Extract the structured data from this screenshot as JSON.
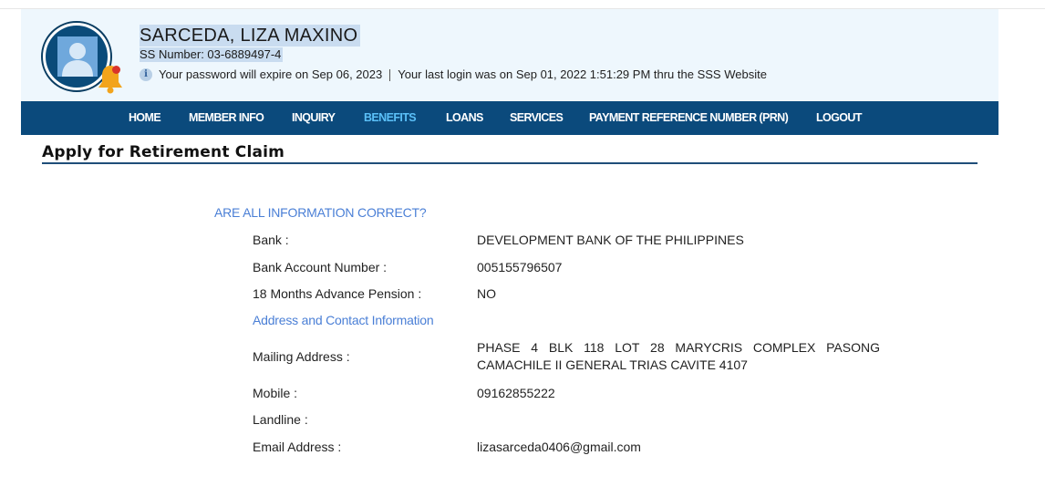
{
  "user": {
    "name": "SARCEDA,  LIZA MAXINO",
    "ss_number": "SS Number: 03-6889497-4",
    "password_notice": "Your password will expire on Sep 06, 2023",
    "last_login": "Your last login was on Sep 01, 2022 1:51:29 PM thru the SSS Website"
  },
  "nav": {
    "items": [
      {
        "label": "HOME",
        "active": false
      },
      {
        "label": "MEMBER INFO",
        "active": false
      },
      {
        "label": "INQUIRY",
        "active": false
      },
      {
        "label": "BENEFITS",
        "active": true
      },
      {
        "label": "LOANS",
        "active": false
      },
      {
        "label": "SERVICES",
        "active": false
      },
      {
        "label": "PAYMENT REFERENCE NUMBER (PRN)",
        "active": false
      },
      {
        "label": "LOGOUT",
        "active": false
      }
    ]
  },
  "page": {
    "title": "Apply for Retirement Claim",
    "section_heading": "ARE ALL INFORMATION CORRECT?",
    "fields": [
      {
        "label": "Bank :",
        "value": "DEVELOPMENT BANK OF THE PHILIPPINES"
      },
      {
        "label": "Bank Account Number :",
        "value": "005155796507"
      },
      {
        "label": "18 Months Advance Pension :",
        "value": "NO"
      }
    ],
    "contact_heading": "Address and Contact Information",
    "contact": [
      {
        "label": "Mailing Address :",
        "value": "PHASE 4 BLK 118 LOT 28 MARYCRIS COMPLEX PASONG CAMACHILE II GENERAL TRIAS CAVITE 4107"
      },
      {
        "label": "Mobile :",
        "value": "09162855222"
      },
      {
        "label": "Landline :",
        "value": ""
      },
      {
        "label": "Email Address :",
        "value": "lizasarceda0406@gmail.com"
      }
    ]
  },
  "colors": {
    "nav_bg": "#0b4a7c",
    "nav_active": "#5bc0f8",
    "header_bg": "#eef7fd",
    "section_heading": "#4a7fd6"
  },
  "icons": [
    "avatar-icon",
    "bell-icon",
    "info-icon"
  ]
}
